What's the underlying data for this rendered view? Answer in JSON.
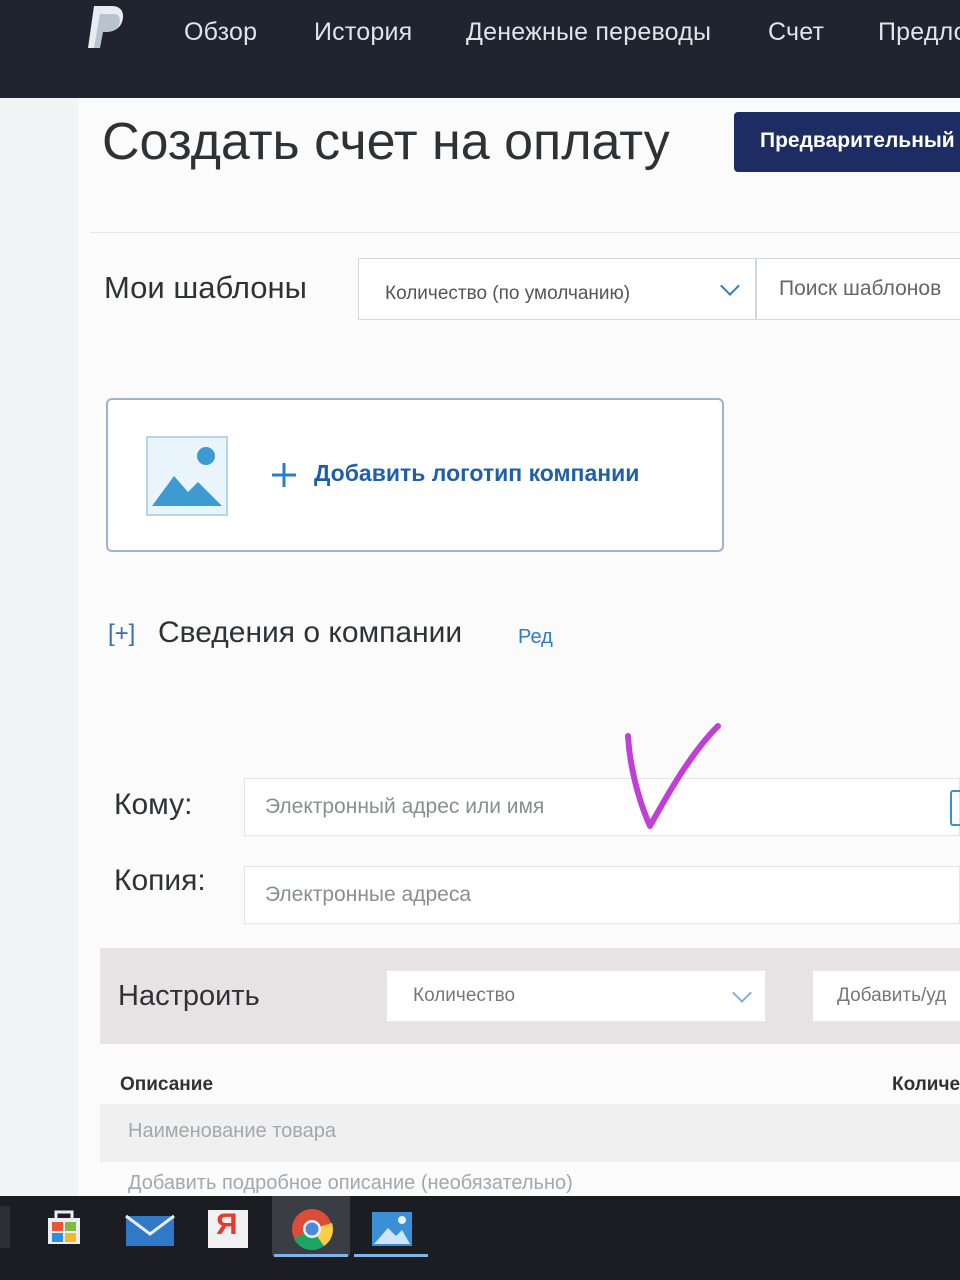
{
  "nav": {
    "items": [
      "Обзор",
      "История",
      "Денежные переводы",
      "Счет",
      "Предло"
    ]
  },
  "page": {
    "title": "Создать счет на оплату",
    "preview_button": "Предварительный"
  },
  "templates": {
    "label": "Мои шаблоны",
    "selected": "Количество (по умолчанию)",
    "search_placeholder": "Поиск шаблонов"
  },
  "logo_box": {
    "add_label": "Добавить логотип компании"
  },
  "company": {
    "toggle": "[+]",
    "title": "Сведения о компании",
    "edit": "Ред"
  },
  "recipients": {
    "to_label": "Кому:",
    "to_placeholder": "Электронный адрес или имя",
    "cc_label": "Копия:",
    "cc_placeholder": "Электронные адреса"
  },
  "customize": {
    "label": "Настроить",
    "selected": "Количество",
    "add_remove": "Добавить/уд"
  },
  "items_table": {
    "columns": [
      "Описание",
      "Количе"
    ],
    "name_placeholder": "Наименование товара",
    "desc_placeholder": "Добавить подробное описание (необязательно)"
  },
  "colors": {
    "nav_bg": "#1f2430",
    "brand_button": "#1d2c63",
    "link": "#2d7bc9",
    "annotation": "#c13fd6"
  },
  "taskbar": {
    "icons": [
      "store-icon",
      "mail-icon",
      "yandex-icon",
      "chrome-icon",
      "photos-icon"
    ],
    "yandex_letter": "Я"
  }
}
